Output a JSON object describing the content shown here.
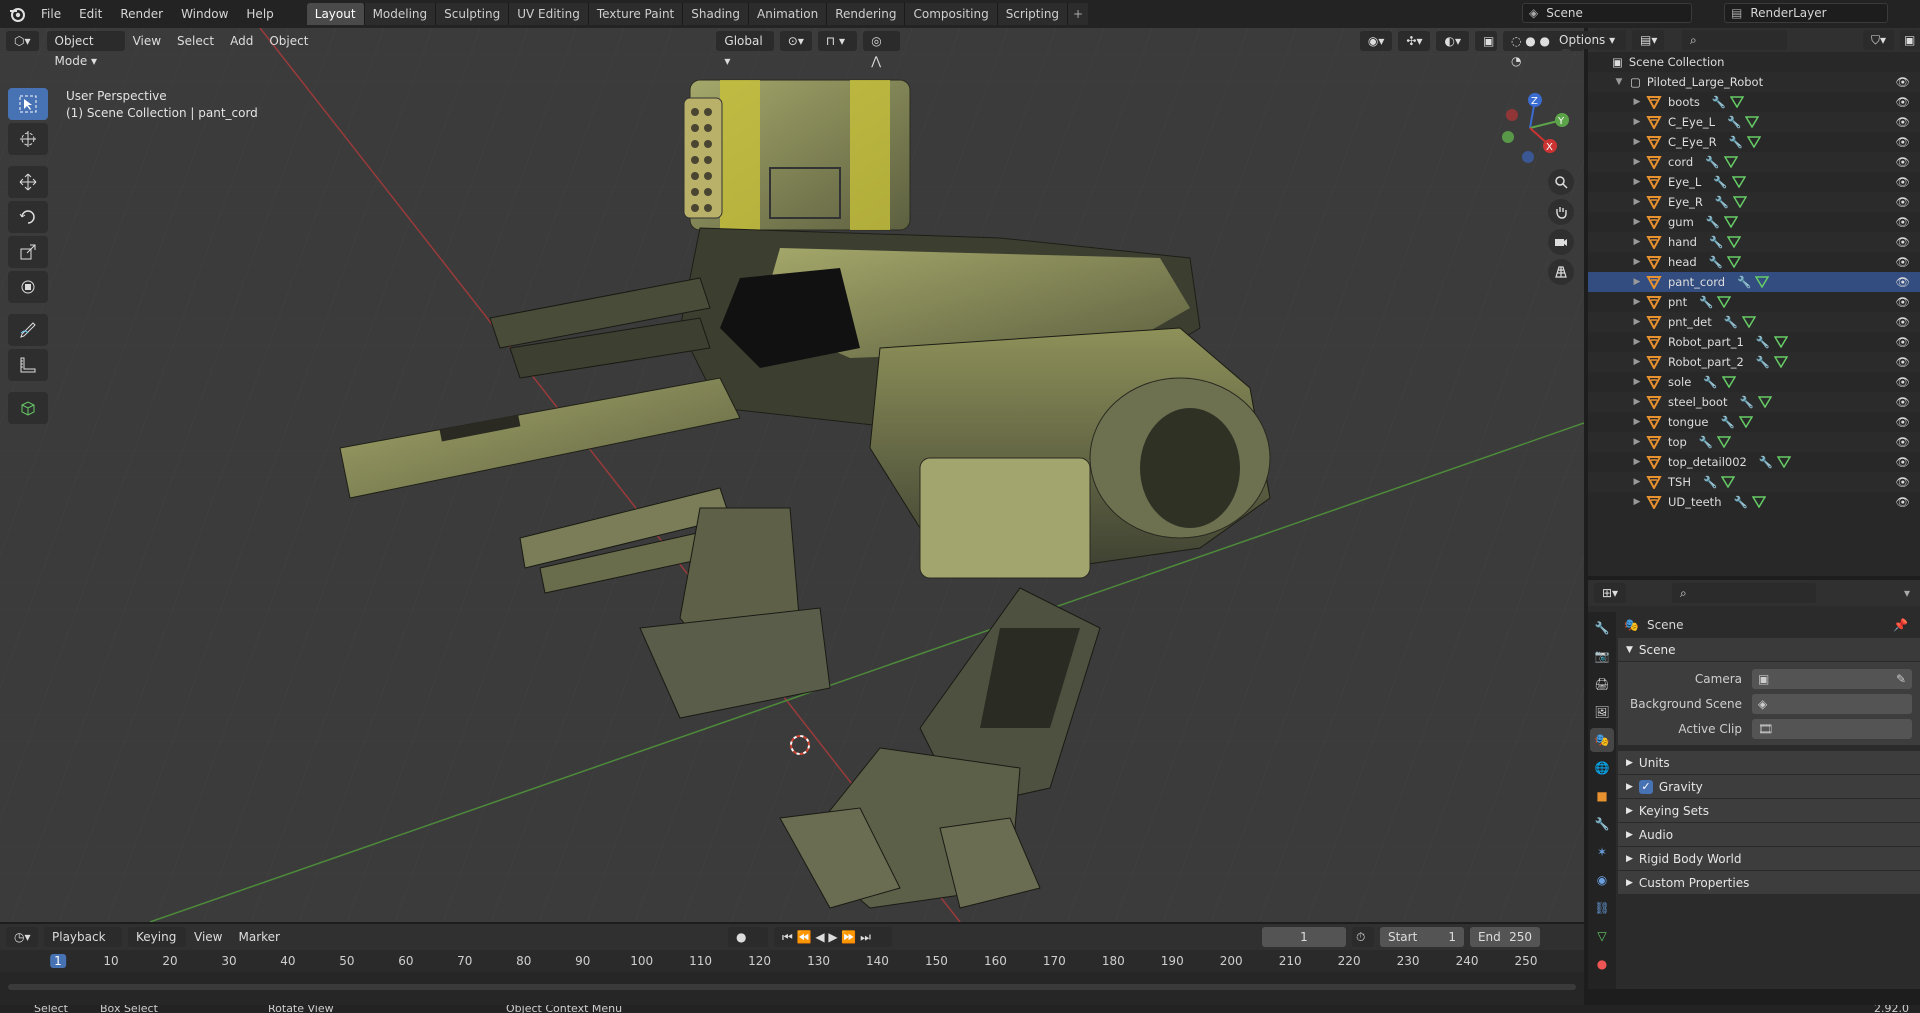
{
  "topbar": {
    "menus": [
      "File",
      "Edit",
      "Render",
      "Window",
      "Help"
    ],
    "workspaces": [
      "Layout",
      "Modeling",
      "Sculpting",
      "UV Editing",
      "Texture Paint",
      "Shading",
      "Animation",
      "Rendering",
      "Compositing",
      "Scripting"
    ],
    "active_workspace": "Layout",
    "scene": "Scene",
    "render_layer": "RenderLayer"
  },
  "viewport": {
    "mode": "Object Mode",
    "menus": [
      "View",
      "Select",
      "Add",
      "Object"
    ],
    "orientation": "Global",
    "options_label": "Options",
    "info_line1": "User Perspective",
    "info_line2": "(1) Scene Collection | pant_cord",
    "gizmo": {
      "x": "X",
      "y": "Y",
      "z": "Z"
    }
  },
  "outliner": {
    "root": "Scene Collection",
    "collection": "Piloted_Large_Robot",
    "items": [
      "boots",
      "C_Eye_L",
      "C_Eye_R",
      "cord",
      "Eye_L",
      "Eye_R",
      "gum",
      "hand",
      "head",
      "pant_cord",
      "pnt",
      "pnt_det",
      "Robot_part_1",
      "Robot_part_2",
      "sole",
      "steel_boot",
      "tongue",
      "top",
      "top_detail002",
      "TSH",
      "UD_teeth"
    ],
    "selected": "pant_cord"
  },
  "properties": {
    "context": "Scene",
    "panel_scene": "Scene",
    "fields": [
      {
        "label": "Camera",
        "value": ""
      },
      {
        "label": "Background Scene",
        "value": ""
      },
      {
        "label": "Active Clip",
        "value": ""
      }
    ],
    "subpanels": [
      "Units",
      "Gravity",
      "Keying Sets",
      "Audio",
      "Rigid Body World",
      "Custom Properties"
    ],
    "gravity_checked": true
  },
  "timeline": {
    "menus": [
      "Playback",
      "Keying",
      "View",
      "Marker"
    ],
    "current_frame": "1",
    "start_label": "Start",
    "start": "1",
    "end_label": "End",
    "end": "250",
    "ticks": [
      "1",
      "10",
      "20",
      "30",
      "40",
      "50",
      "60",
      "70",
      "80",
      "90",
      "100",
      "110",
      "120",
      "130",
      "140",
      "150",
      "160",
      "170",
      "180",
      "190",
      "200",
      "210",
      "220",
      "230",
      "240",
      "250"
    ]
  },
  "statusbar": {
    "select": "Select",
    "box_select": "Box Select",
    "rotate_view": "Rotate View",
    "context_menu": "Object Context Menu",
    "version": "2.92.0"
  },
  "colors": {
    "accent": "#4772b3",
    "selected_row": "#334d80",
    "mesh_icon": "#e8922f",
    "x_axis": "#a83838",
    "y_axis": "#4f9a3b"
  }
}
